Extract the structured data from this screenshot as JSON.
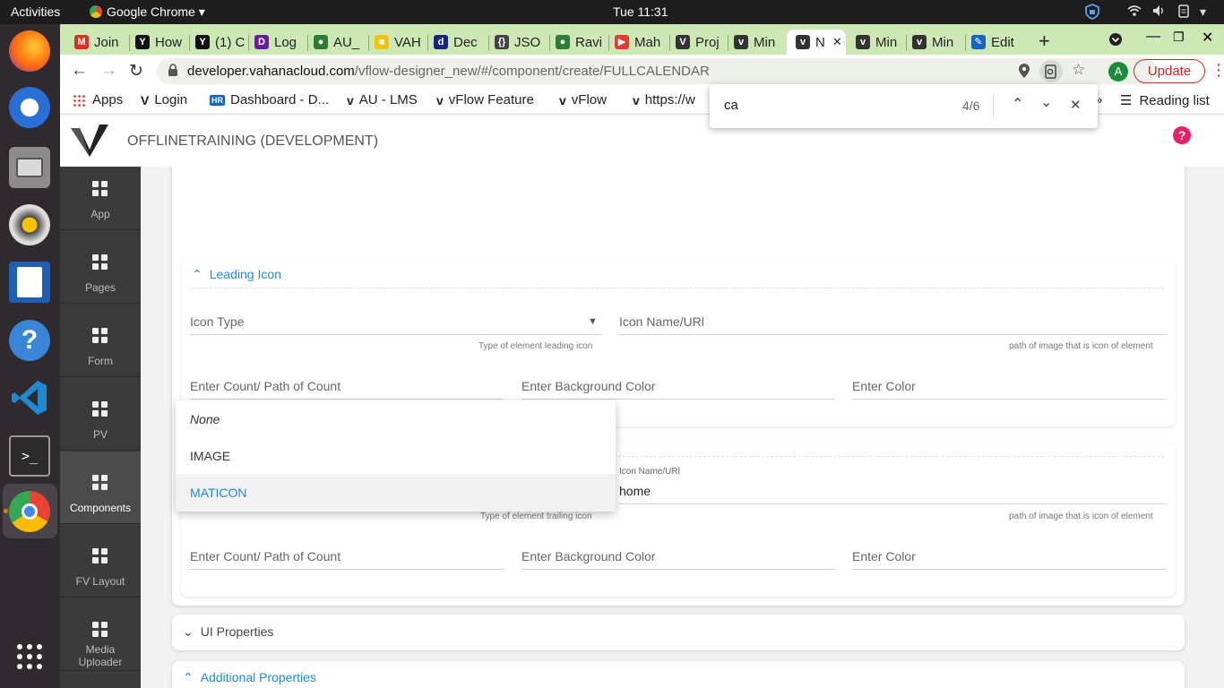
{
  "topbar": {
    "activities": "Activities",
    "app_menu": "Google Chrome",
    "clock": "Tue 11:31"
  },
  "tabs": [
    {
      "label": "Join",
      "fav": "M",
      "color": "#d93025"
    },
    {
      "label": "How",
      "fav": "Y",
      "color": "#111111"
    },
    {
      "label": "(1) C",
      "fav": "Y",
      "color": "#111111"
    },
    {
      "label": "Log",
      "fav": "D",
      "color": "#6a1b9a"
    },
    {
      "label": "AU_",
      "fav": "●",
      "color": "#2e7d32"
    },
    {
      "label": "VAH",
      "fav": "■",
      "color": "#f4c20d"
    },
    {
      "label": "Dec",
      "fav": "d",
      "color": "#1a237e"
    },
    {
      "label": "JSO",
      "fav": "{}",
      "color": "#444444"
    },
    {
      "label": "Ravi",
      "fav": "●",
      "color": "#2e7d32"
    },
    {
      "label": "Mah",
      "fav": "▶",
      "color": "#e53935"
    },
    {
      "label": "Proj",
      "fav": "V",
      "color": "#333333"
    },
    {
      "label": "Min",
      "fav": "v",
      "color": "#333333"
    },
    {
      "label": "N",
      "fav": "v",
      "color": "#333333"
    },
    {
      "label": "Min",
      "fav": "v",
      "color": "#333333"
    },
    {
      "label": "Min",
      "fav": "v",
      "color": "#333333"
    },
    {
      "label": "Edit",
      "fav": "✎",
      "color": "#1565c0"
    }
  ],
  "toolbar": {
    "url_host": "developer.vahanacloud.com",
    "url_path": "/vflow-designer_new/#/component/create/FULLCALENDAR",
    "profile_initial": "A",
    "update_label": "Update"
  },
  "bookmarks": {
    "apps": "Apps",
    "items": [
      "Login",
      "Dashboard - D...",
      "AU - LMS",
      "vFlow Feature",
      "vFlow",
      "https://w"
    ],
    "reading_list": "Reading list"
  },
  "findbar": {
    "query": "ca",
    "count": "4/6"
  },
  "app": {
    "title": "OFFLINETRAINING (DEVELOPMENT)",
    "help": "?"
  },
  "sidebar": {
    "items": [
      {
        "label": "App"
      },
      {
        "label": "Pages"
      },
      {
        "label": "Form"
      },
      {
        "label": "PV"
      },
      {
        "label": "Components"
      },
      {
        "label": "FV Layout"
      },
      {
        "label": "Media Uploader"
      }
    ]
  },
  "leading": {
    "title": "Leading Icon",
    "icon_type_label": "Icon Type",
    "icon_type_hint": "Type of element leading icon",
    "icon_name_label": "Icon Name/URl",
    "icon_name_hint": "path of image that is icon of element",
    "count_label": "Enter Count/ Path of Count",
    "bg_label": "Enter Background Color",
    "color_label": "Enter Color"
  },
  "trailing": {
    "icon_name_label": "Icon Name/URl",
    "icon_name_value": "home",
    "icon_type_hint": "Type of element trailing icon",
    "icon_name_hint": "path of image that is icon of element",
    "count_label": "Enter Count/ Path of Count",
    "bg_label": "Enter Background Color",
    "color_label": "Enter Color"
  },
  "dropdown": {
    "options": [
      "None",
      "IMAGE",
      "MATICON"
    ],
    "selected_index": 2
  },
  "ui_properties": "UI Properties",
  "additional_properties": "Additional Properties"
}
